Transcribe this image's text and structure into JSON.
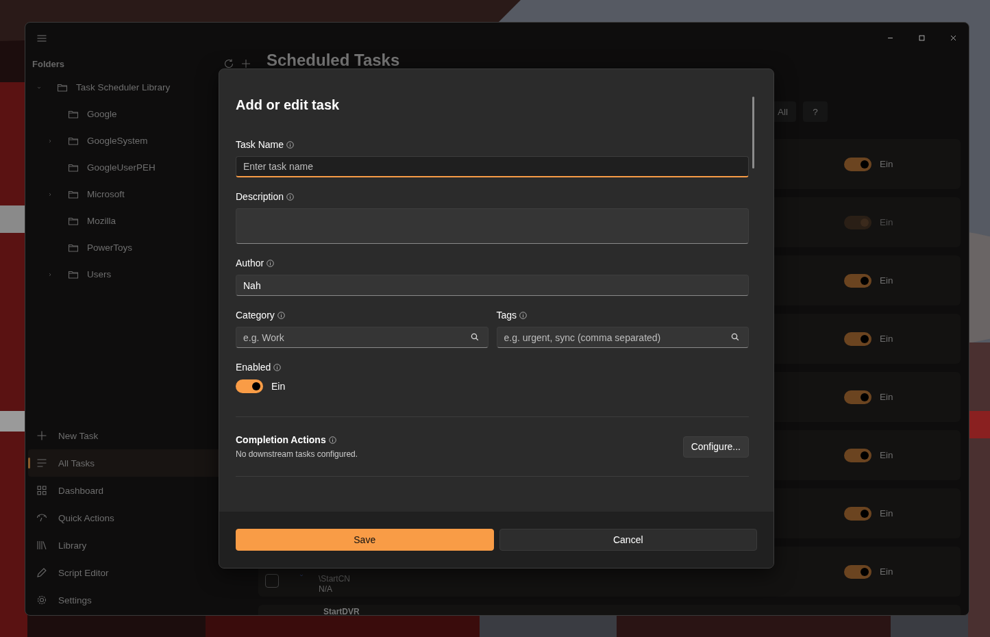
{
  "sidebar": {
    "header": "Folders",
    "folders": [
      {
        "label": "Task Scheduler Library",
        "expandable": true,
        "expanded": true,
        "children": [
          {
            "label": "Google",
            "expandable": false
          },
          {
            "label": "GoogleSystem",
            "expandable": true,
            "expanded": false
          },
          {
            "label": "GoogleUserPEH",
            "expandable": false
          },
          {
            "label": "Microsoft",
            "expandable": true,
            "expanded": false
          },
          {
            "label": "Mozilla",
            "expandable": false
          },
          {
            "label": "PowerToys",
            "expandable": false
          },
          {
            "label": "Users",
            "expandable": true,
            "expanded": false
          }
        ]
      }
    ],
    "nav": [
      {
        "label": "New Task",
        "selected": false
      },
      {
        "label": "All Tasks",
        "selected": true
      },
      {
        "label": "Dashboard",
        "selected": false
      },
      {
        "label": "Quick Actions",
        "selected": false
      },
      {
        "label": "Library",
        "selected": false
      },
      {
        "label": "Script Editor",
        "selected": false
      },
      {
        "label": "Settings",
        "selected": false
      }
    ]
  },
  "main": {
    "title": "Scheduled Tasks",
    "toolbar": [
      "All",
      "?"
    ],
    "tasks": [
      {
        "on": true,
        "disabled": false,
        "toggle_label": "Ein"
      },
      {
        "on": true,
        "disabled": true,
        "toggle_label": "Ein"
      },
      {
        "on": true,
        "disabled": false,
        "toggle_label": "Ein"
      },
      {
        "on": true,
        "disabled": false,
        "toggle_label": "Ein"
      },
      {
        "on": true,
        "disabled": false,
        "toggle_label": "Ein"
      },
      {
        "on": true,
        "disabled": false,
        "toggle_label": "Ein"
      },
      {
        "on": true,
        "disabled": false,
        "toggle_label": "Ein"
      },
      {
        "on": true,
        "disabled": false,
        "toggle_label": "Ein",
        "checked": false,
        "path": "\\StartCN",
        "status": "N/A"
      },
      {
        "name": "StartDVR"
      }
    ]
  },
  "dialog": {
    "title": "Add or edit task",
    "fields": [
      {
        "kind": "text",
        "label": "Task Name",
        "placeholder": "Enter task name",
        "focused": true
      },
      {
        "kind": "multiline",
        "label": "Description",
        "focused": false
      },
      {
        "kind": "text",
        "label": "Author",
        "value": "Nah",
        "focused": false
      }
    ],
    "search_fields": [
      {
        "label": "Category",
        "placeholder": "e.g. Work"
      },
      {
        "label": "Tags",
        "placeholder": "e.g. urgent, sync (comma separated)"
      }
    ],
    "enabled": {
      "label": "Enabled",
      "on": true,
      "state_label": "Ein"
    },
    "completion": {
      "title": "Completion Actions",
      "note": "No downstream tasks configured.",
      "button": "Configure..."
    },
    "buttons": [
      {
        "label": "Save",
        "primary": true
      },
      {
        "label": "Cancel",
        "primary": false
      }
    ]
  }
}
